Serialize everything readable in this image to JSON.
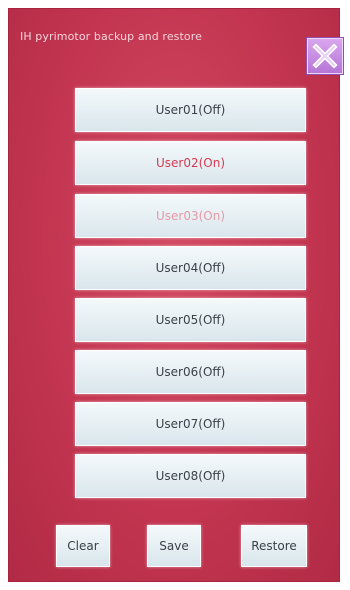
{
  "window": {
    "title": "IH pyrimotor backup and restore",
    "close_icon": "close-icon"
  },
  "users": [
    {
      "label": "User01(Off)",
      "state": "normal"
    },
    {
      "label": "User02(On)",
      "state": "active"
    },
    {
      "label": "User03(On)",
      "state": "dim"
    },
    {
      "label": "User04(Off)",
      "state": "normal"
    },
    {
      "label": "User05(Off)",
      "state": "normal"
    },
    {
      "label": "User06(Off)",
      "state": "normal"
    },
    {
      "label": "User07(Off)",
      "state": "normal"
    },
    {
      "label": "User08(Off)",
      "state": "normal"
    }
  ],
  "actions": {
    "clear": "Clear",
    "save": "Save",
    "restore": "Restore"
  },
  "colors": {
    "panel_background": "#c33550",
    "button_face": "#e6eff3",
    "active_text": "#d63a52",
    "close_button": "#c58be2"
  }
}
